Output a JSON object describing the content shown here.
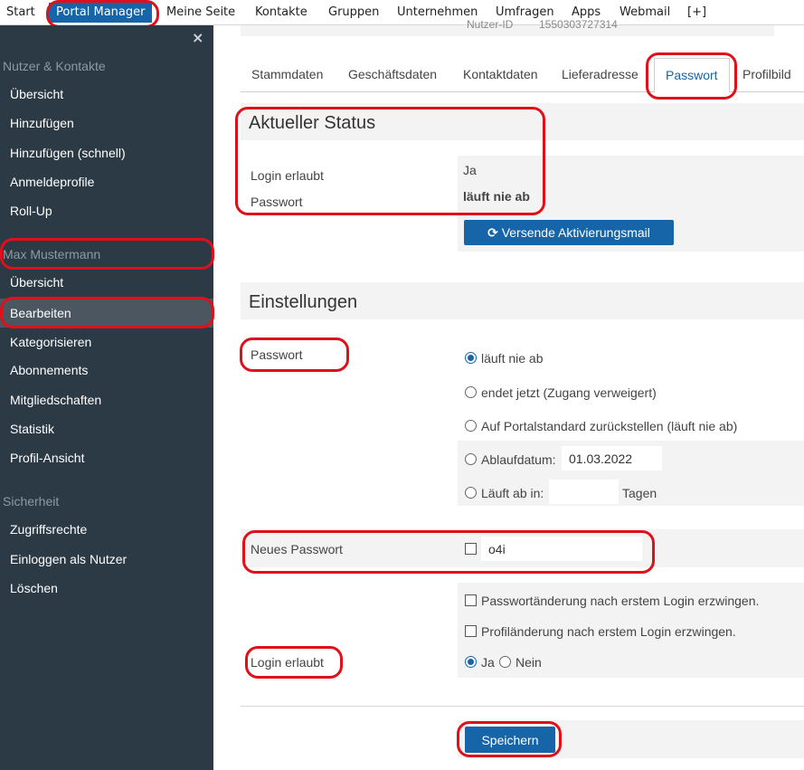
{
  "topnav": {
    "items": [
      "Start",
      "Portal Manager",
      "Meine Seite",
      "Kontakte",
      "Gruppen",
      "Unternehmen",
      "Umfragen",
      "Apps",
      "Webmail",
      "[+]"
    ]
  },
  "sidebar": {
    "close_icon": "×",
    "section1": {
      "heading": "Nutzer & Kontakte",
      "items": [
        "Übersicht",
        "Hinzufügen",
        "Hinzufügen (schnell)",
        "Anmeldeprofile",
        "Roll-Up"
      ]
    },
    "section2": {
      "heading": "Max Mustermann",
      "items": [
        "Übersicht",
        "Bearbeiten",
        "Kategorisieren",
        "Abonnements",
        "Mitgliedschaften",
        "Statistik",
        "Profil-Ansicht"
      ]
    },
    "section3": {
      "heading": "Sicherheit",
      "items": [
        "Zugriffsrechte",
        "Einloggen als Nutzer",
        "Löschen"
      ]
    }
  },
  "main": {
    "partial_field_label": "Nutzer-ID",
    "partial_field_value": "1550303727314",
    "tabs": [
      "Stammdaten",
      "Geschäftsdaten",
      "Kontaktdaten",
      "Lieferadresse",
      "Passwort",
      "Profilbild"
    ],
    "status": {
      "title": "Aktueller Status",
      "login_label": "Login erlaubt",
      "login_value": "Ja",
      "password_label": "Passwort",
      "password_value": "läuft nie ab",
      "activation_button": "Versende Aktivierungsmail",
      "refresh_icon": "⟳"
    },
    "settings": {
      "title": "Einstellungen",
      "password_label": "Passwort",
      "password_options": [
        "läuft nie ab",
        "endet jetzt (Zugang verweigert)",
        "Auf Portalstandard zurückstellen (läuft nie ab)",
        "Ablaufdatum:",
        "Läuft ab in:"
      ],
      "password_selected": "läuft nie ab",
      "expiry_date_value": "01.03.2022",
      "expires_in_value": "",
      "expires_in_unit": "Tagen",
      "new_password_label": "Neues Passwort",
      "new_password_value": "o4i",
      "new_password_checked": false,
      "force_password_change": "Passwortänderung nach erstem Login erzwingen.",
      "force_profile_change": "Profiländerung nach erstem Login erzwingen.",
      "login_allowed_label": "Login erlaubt",
      "login_allowed_yes": "Ja",
      "login_allowed_no": "Nein",
      "login_allowed_selected": "Ja"
    },
    "save_button": "Speichern"
  },
  "colors": {
    "accent": "#1565a8",
    "sidebar_bg": "#2b3a45",
    "sidebar_active": "#4b5660",
    "highlight": "#e0101a",
    "band_bg": "#f3f3f3"
  }
}
